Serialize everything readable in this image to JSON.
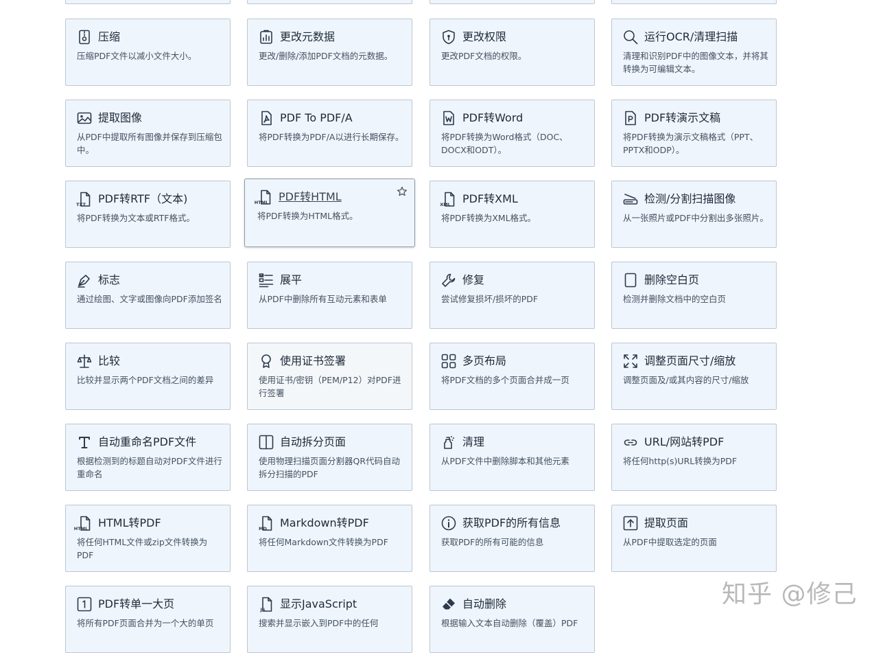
{
  "tools": [
    {
      "icon": "compress-icon",
      "title": "压缩",
      "desc": "压缩PDF文件以减小文件大小。"
    },
    {
      "icon": "metadata-icon",
      "title": "更改元数据",
      "desc": "更改/删除/添加PDF文档的元数据。"
    },
    {
      "icon": "shield-icon",
      "title": "更改权限",
      "desc": "更改PDF文档的权限。"
    },
    {
      "icon": "search-icon",
      "title": "运行OCR/清理扫描",
      "desc": "清理和识别PDF中的图像文本，并将其转换为可编辑文本。"
    },
    {
      "icon": "image-icon",
      "title": "提取图像",
      "desc": "从PDF中提取所有图像并保存到压缩包中。"
    },
    {
      "icon": "pdfa-icon",
      "title": "PDF To PDF/A",
      "desc": "将PDF转换为PDF/A以进行长期保存。"
    },
    {
      "icon": "word-file-icon",
      "title": "PDF转Word",
      "desc": "将PDF转换为Word格式（DOC、DOCX和ODT）。"
    },
    {
      "icon": "presentation-file-icon",
      "title": "PDF转演示文稿",
      "desc": "将PDF转换为演示文稿格式（PPT、PPTX和ODP）。"
    },
    {
      "icon": "txt-file-icon",
      "title": "PDF转RTF（文本)",
      "desc": "将PDF转换为文本或RTF格式。"
    },
    {
      "icon": "html-file-icon",
      "title": "PDF转HTML",
      "desc": "将PDF转换为HTML格式。",
      "featured": true,
      "star": "star-icon"
    },
    {
      "icon": "xml-file-icon",
      "title": "PDF转XML",
      "desc": "将PDF转换为XML格式。"
    },
    {
      "icon": "scanner-icon",
      "title": "检测/分割扫描图像",
      "desc": "从一张照片或PDF中分割出多张照片。"
    },
    {
      "icon": "pen-icon",
      "title": "标志",
      "desc": "通过绘图、文字或图像向PDF添加签名"
    },
    {
      "icon": "flatten-icon",
      "title": "展平",
      "desc": "从PDF中删除所有互动元素和表单"
    },
    {
      "icon": "wrench-icon",
      "title": "修复",
      "desc": "尝试修复损坏/损坏的PDF"
    },
    {
      "icon": "blank-page-icon",
      "title": "删除空白页",
      "desc": "检测并删除文档中的空白页"
    },
    {
      "icon": "scale-icon",
      "title": "比较",
      "desc": "比较并显示两个PDF文档之间的差异"
    },
    {
      "icon": "certificate-icon",
      "title": "使用证书签署",
      "desc": "使用证书/密钥（PEM/P12）对PDF进行签署",
      "muted": true
    },
    {
      "icon": "grid-icon",
      "title": "多页布局",
      "desc": "将PDF文档的多个页面合并成一页"
    },
    {
      "icon": "resize-icon",
      "title": "调整页面尺寸/缩放",
      "desc": "调整页面及/或其内容的尺寸/缩放"
    },
    {
      "icon": "text-t-icon",
      "title": "自动重命名PDF文件",
      "desc": "根据检测到的标题自动对PDF文件进行重命名"
    },
    {
      "icon": "split-page-icon",
      "title": "自动拆分页面",
      "desc": "使用物理扫描页面分割器QR代码自动拆分扫描的PDF"
    },
    {
      "icon": "sanitize-icon",
      "title": "清理",
      "desc": "从PDF文件中删除脚本和其他元素"
    },
    {
      "icon": "link-icon",
      "title": "URL/网站转PDF",
      "desc": "将任何http(s)URL转换为PDF"
    },
    {
      "icon": "html-file-icon",
      "title": "HTML转PDF",
      "desc": "将任何HTML文件或zip文件转换为PDF"
    },
    {
      "icon": "md-file-icon",
      "title": "Markdown转PDF",
      "desc": "将任何Markdown文件转换为PDF"
    },
    {
      "icon": "info-icon",
      "title": "获取PDF的所有信息",
      "desc": "获取PDF的所有可能的信息"
    },
    {
      "icon": "upload-box-icon",
      "title": "提取页面",
      "desc": "从PDF中提取选定的页面"
    },
    {
      "icon": "one-page-icon",
      "title": "PDF转单一大页",
      "desc": "将所有PDF页面合并为一个大的单页"
    },
    {
      "icon": "js-file-icon",
      "title": "显示JavaScript",
      "desc": "搜索并显示嵌入到PDF中的任何"
    },
    {
      "icon": "eraser-icon",
      "title": "自动删除",
      "desc": "根据输入文本自动删除（覆盖）PDF"
    }
  ],
  "watermark": "知乎 @修己"
}
